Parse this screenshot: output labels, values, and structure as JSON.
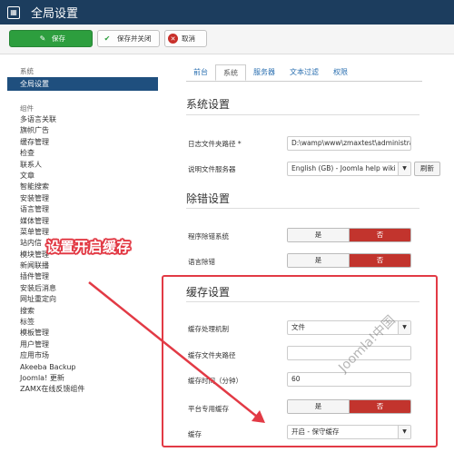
{
  "header": {
    "title": "全局设置",
    "logo_icon": "joomla-grid-icon"
  },
  "toolbar": {
    "save_label": "保存",
    "save_close_label": "保存并关闭",
    "cancel_label": "取消"
  },
  "sidebar": {
    "system_heading": "系统",
    "active_item": "全局设置",
    "components_heading": "组件",
    "items": [
      "多语言关联",
      "旗帜广告",
      "缓存管理",
      "检查",
      "联系人",
      "文章",
      "智能搜索",
      "安装管理",
      "语言管理",
      "媒体管理",
      "菜单管理",
      "站内信",
      "模块管理",
      "新闻联播",
      "插件管理",
      "安装后消息",
      "网址重定向",
      "搜索",
      "标签",
      "模板管理",
      "用户管理",
      "应用市场",
      "Akeeba Backup",
      "Joomla! 更新",
      "ZAMX在线反馈组件"
    ]
  },
  "tabs": [
    "前台",
    "系统",
    "服务器",
    "文本过滤",
    "权限"
  ],
  "active_tab": "系统",
  "system": {
    "heading": "系统设置",
    "log_path_label": "日志文件夹路径 *",
    "log_path_value": "D:\\wamp\\www\\zmaxtest\\administrat",
    "help_server_label": "说明文件服务器",
    "help_server_value": "English (GB) - Joomla help wiki",
    "refresh_label": "刷新"
  },
  "debug": {
    "heading": "除错设置",
    "debug_system_label": "程序除错系统",
    "debug_lang_label": "语言除错",
    "yes": "是",
    "no": "否"
  },
  "cache": {
    "heading": "缓存设置",
    "handler_label": "缓存处理机制",
    "handler_value": "文件",
    "path_label": "缓存文件夹路径",
    "path_value": "",
    "time_label": "缓存时间（分钟）",
    "time_value": "60",
    "platform_label": "平台专用缓存",
    "cache_label": "缓存",
    "cache_value": "开启 - 保守缓存"
  },
  "annotation": {
    "text": "设置开启缓存",
    "color": "#e23a45"
  },
  "watermark": "Joomla!中国"
}
